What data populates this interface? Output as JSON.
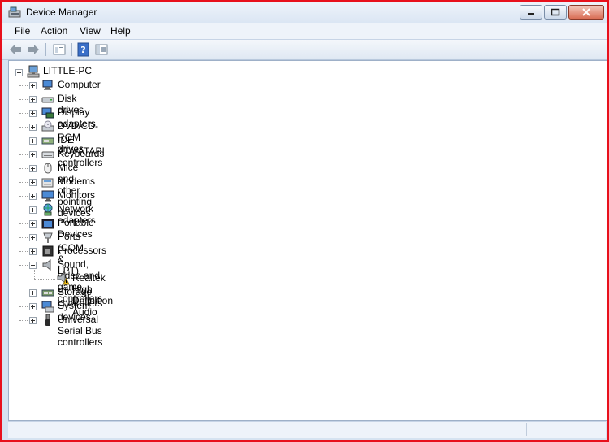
{
  "window": {
    "title": "Device Manager",
    "border_color": "#e8101c"
  },
  "menu": [
    "File",
    "Action",
    "View",
    "Help"
  ],
  "toolbar": {
    "icons": [
      "back-arrow-icon",
      "forward-arrow-icon",
      "properties-icon",
      "help-icon",
      "show-hide-console-tree-icon"
    ]
  },
  "tree": {
    "root": "LITTLE-PC",
    "categories": [
      {
        "label": "Computer",
        "icon": "computer-icon"
      },
      {
        "label": "Disk drives",
        "icon": "disk-drive-icon"
      },
      {
        "label": "Display adapters",
        "icon": "display-adapter-icon"
      },
      {
        "label": "DVD/CD-ROM drives",
        "icon": "dvd-drive-icon"
      },
      {
        "label": "IDE ATA/ATAPI controllers",
        "icon": "ide-controller-icon"
      },
      {
        "label": "Keyboards",
        "icon": "keyboard-icon"
      },
      {
        "label": "Mice and other pointing devices",
        "icon": "mouse-icon"
      },
      {
        "label": "Modems",
        "icon": "modem-icon"
      },
      {
        "label": "Monitors",
        "icon": "monitor-icon"
      },
      {
        "label": "Network adapters",
        "icon": "network-adapter-icon"
      },
      {
        "label": "Portable Devices",
        "icon": "portable-device-icon"
      },
      {
        "label": "Ports (COM & LPT)",
        "icon": "port-icon"
      },
      {
        "label": "Processors",
        "icon": "processor-icon"
      },
      {
        "label": "Sound, video and game controllers",
        "icon": "speaker-icon",
        "expanded": true,
        "children": [
          {
            "label": "Realtek High Definition Audio",
            "icon": "speaker-warning-icon"
          }
        ]
      },
      {
        "label": "Storage controllers",
        "icon": "storage-controller-icon"
      },
      {
        "label": "System devices",
        "icon": "system-device-icon"
      },
      {
        "label": "Universal Serial Bus controllers",
        "icon": "usb-icon"
      }
    ]
  }
}
